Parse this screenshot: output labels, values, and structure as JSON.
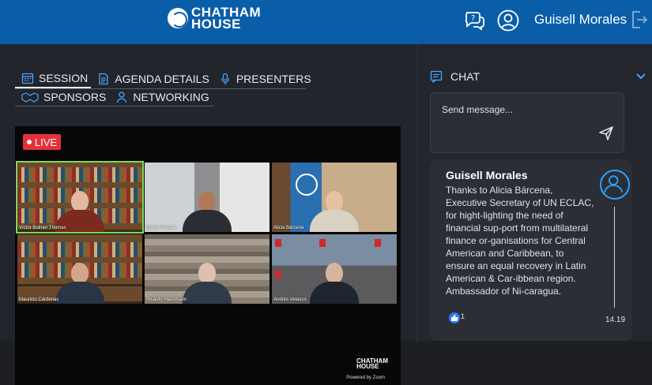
{
  "header": {
    "logo_line1": "CHATHAM",
    "logo_line2": "HOUSE",
    "user_name": "Guisell Morales"
  },
  "tabs": [
    {
      "label": "SESSION",
      "icon": "calendar-icon",
      "active": true
    },
    {
      "label": "AGENDA DETAILS",
      "icon": "document-icon",
      "active": false
    },
    {
      "label": "PRESENTERS",
      "icon": "microphone-icon",
      "active": false
    },
    {
      "label": "SPONSORS",
      "icon": "handshake-icon",
      "active": false
    },
    {
      "label": "NETWORKING",
      "icon": "person-icon",
      "active": false
    }
  ],
  "video": {
    "live_label": "LIVE",
    "participants": [
      "Víctor Bulmer Thomas",
      "Eswar Prasad",
      "Alicia Bárcena",
      "Mauricio Cárdenas",
      "Ricardo Hausmann",
      "Andrés Velasco"
    ],
    "watermark_line1": "CHATHAM",
    "watermark_line2": "HOUSE",
    "powered_by": "Powered by Zoom"
  },
  "chat": {
    "title": "CHAT",
    "placeholder": "Send message...",
    "message": {
      "author": "Guisell Morales",
      "text": "Thanks to Alicia Bárcena, Executive Secretary of UN ECLAC, for hight-lighting the need of financial sup-port from multilateral finance or-ganisations for Central American and Caribbean, to ensure an equal recovery in Latin American & Car-ibbean region. Ambassador of Ni-caragua.",
      "likes": "1",
      "time": "14.19"
    }
  },
  "colors": {
    "brand_blue": "#0a5ea8",
    "live_red": "#e5313a",
    "active_speaker": "#7ed957",
    "avatar_ring": "#2aa3ff"
  }
}
